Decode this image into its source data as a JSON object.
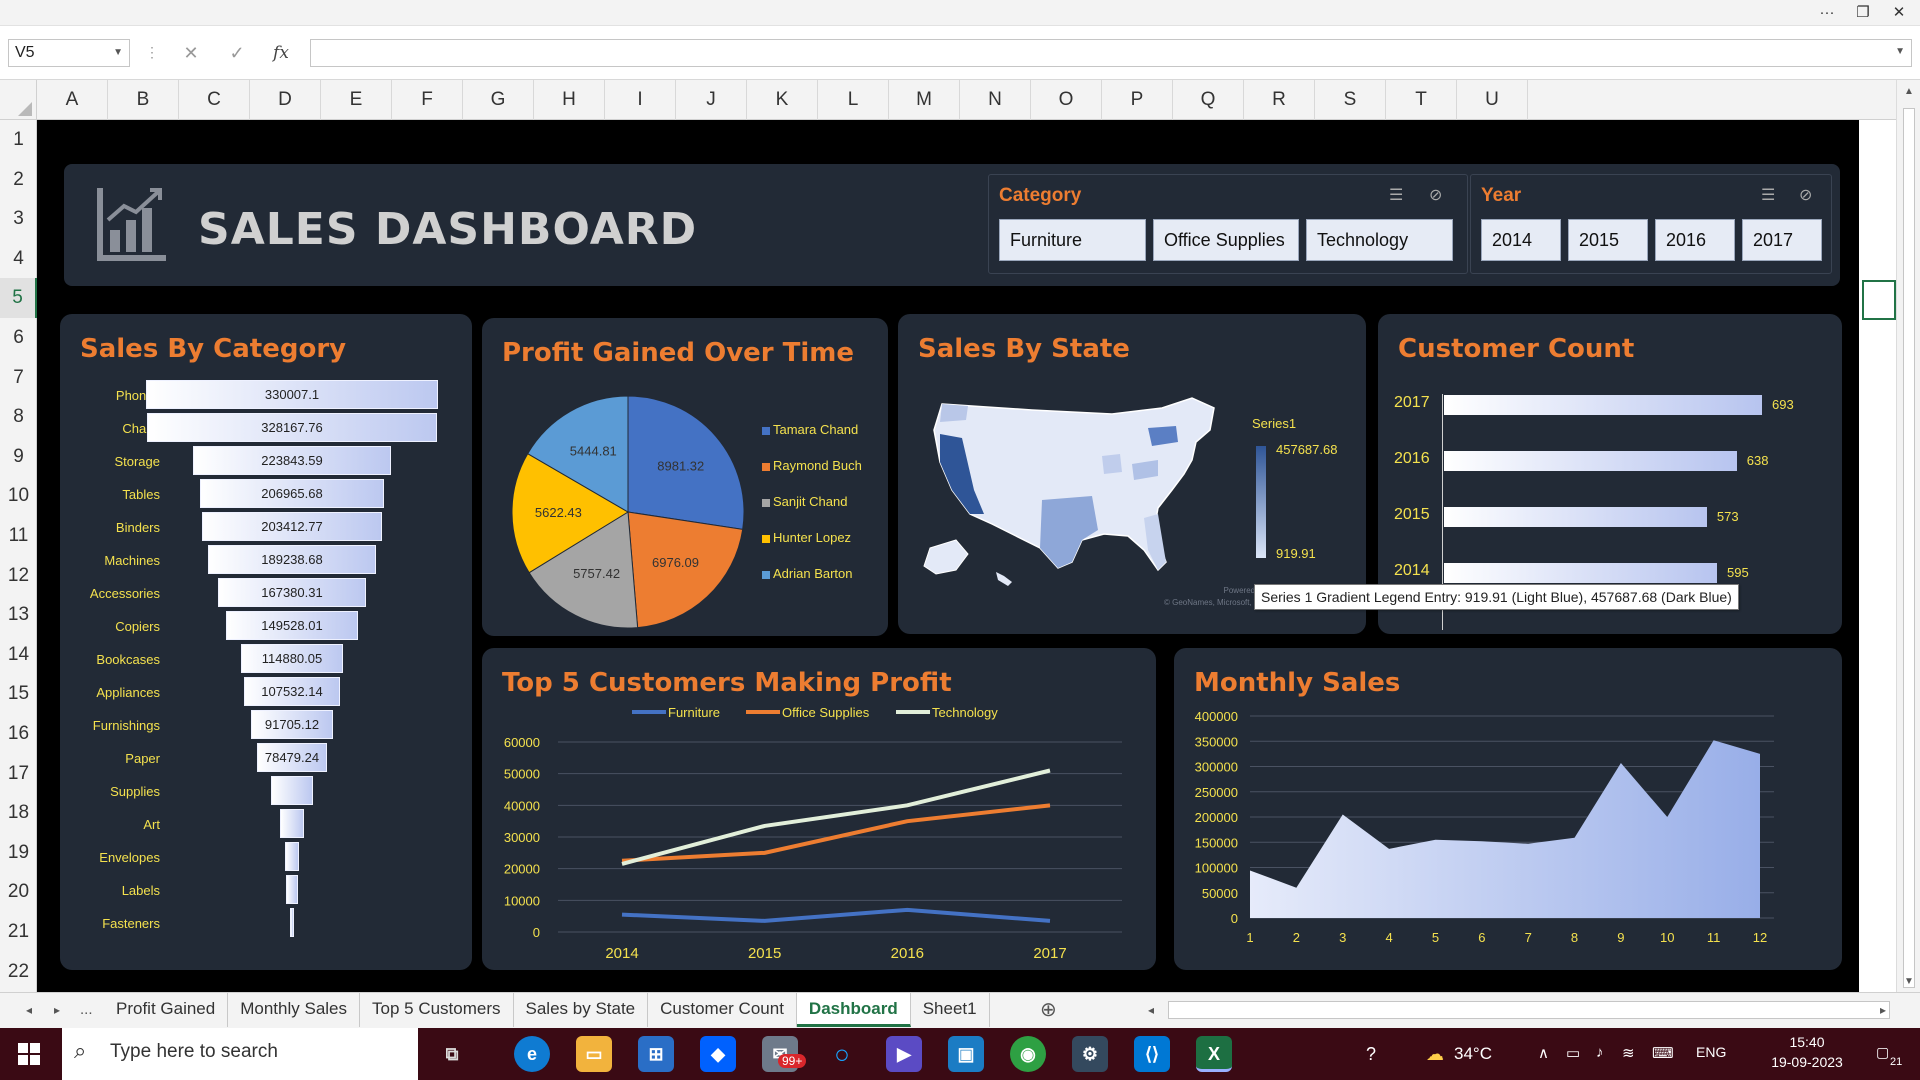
{
  "window": {
    "more_icon": "···",
    "restore_icon": "❐",
    "close_icon": "✕"
  },
  "formula_bar": {
    "name_box": "V5",
    "cancel_icon": "✕",
    "enter_icon": "✓",
    "fx_label": "fx",
    "formula_value": ""
  },
  "columns": [
    "A",
    "B",
    "C",
    "D",
    "E",
    "F",
    "G",
    "H",
    "I",
    "J",
    "K",
    "L",
    "M",
    "N",
    "O",
    "P",
    "Q",
    "R",
    "S",
    "T",
    "U"
  ],
  "rows": [
    "1",
    "2",
    "3",
    "4",
    "5",
    "6",
    "7",
    "8",
    "9",
    "10",
    "11",
    "12",
    "13",
    "14",
    "15",
    "16",
    "17",
    "18",
    "19",
    "20",
    "21",
    "22"
  ],
  "selected_row": "5",
  "dashboard": {
    "title": "SALES DASHBOARD",
    "category_slicer": {
      "title": "Category",
      "items": [
        "Furniture",
        "Office  Supplies",
        "Technology"
      ]
    },
    "year_slicer": {
      "title": "Year",
      "items": [
        "2014",
        "2015",
        "2016",
        "2017"
      ]
    }
  },
  "panels": {
    "sales_by_category": "Sales By Category",
    "profit_over_time": "Profit Gained Over Time",
    "sales_by_state": "Sales By State",
    "customer_count": "Customer Count",
    "top5": "Top 5 Customers Making Profit",
    "monthly": "Monthly Sales"
  },
  "map": {
    "legend_title": "Series1",
    "max_label": "457687.68",
    "min_label": "919.91",
    "credit_1": "Powered by Bing",
    "credit_2": "© GeoNames, Microsoft, TomTom",
    "tooltip": "Series 1 Gradient Legend Entry: 919.91 (Light Blue), 457687.68 (Dark Blue)"
  },
  "chart_data": [
    {
      "type": "bar",
      "title": "Sales By Category",
      "categories": [
        "Phones",
        "Chairs",
        "Storage",
        "Tables",
        "Binders",
        "Machines",
        "Accessories",
        "Copiers",
        "Bookcases",
        "Appliances",
        "Furnishings",
        "Paper",
        "Supplies",
        "Art",
        "Envelopes",
        "Labels",
        "Fasteners"
      ],
      "values": [
        330007.1,
        328167.76,
        223843.59,
        206965.68,
        203412.77,
        189238.68,
        167380.31,
        149528.01,
        114880.05,
        107532.14,
        91705.12,
        78479.24,
        46673,
        27119,
        16476,
        12486,
        3024
      ],
      "value_labels": [
        "330007.1",
        "328167.76",
        "223843.59",
        "206965.68",
        "203412.77",
        "189238.68",
        "167380.31",
        "149528.01",
        "114880.05",
        "107532.14",
        "91705.12",
        "78479.24",
        "",
        "",
        "",
        "",
        ""
      ]
    },
    {
      "type": "pie",
      "title": "Profit Gained Over Time",
      "labels": [
        "Tamara Chand",
        "Raymond Buch",
        "Sanjit Chand",
        "Hunter Lopez",
        "Adrian Barton"
      ],
      "values": [
        8981.32,
        6976.09,
        5757.42,
        5622.43,
        5444.81
      ],
      "value_labels": [
        "8981.32",
        "6976.09",
        "5757.42",
        "5622.43",
        "5444.81"
      ],
      "colors": [
        "#4472c4",
        "#ed7d31",
        "#a5a5a5",
        "#ffc000",
        "#5b9bd5"
      ]
    },
    {
      "type": "bar",
      "title": "Customer Count",
      "categories": [
        "2017",
        "2016",
        "2015",
        "2014"
      ],
      "values": [
        693,
        638,
        573,
        595
      ],
      "value_labels": [
        "693",
        "638",
        "573",
        "595"
      ]
    },
    {
      "type": "line",
      "title": "Top 5 Customers Making Profit",
      "x": [
        "2014",
        "2015",
        "2016",
        "2017"
      ],
      "ylim": [
        0,
        60000
      ],
      "yticks": [
        "0",
        "10000",
        "20000",
        "30000",
        "40000",
        "50000",
        "60000"
      ],
      "series": [
        {
          "name": "Furniture",
          "color": "#4472c4",
          "values": [
            5500,
            3500,
            7000,
            3500
          ]
        },
        {
          "name": "Office Supplies",
          "color": "#ed7d31",
          "values": [
            22500,
            25000,
            35000,
            40000
          ]
        },
        {
          "name": "Technology",
          "color": "#e2efda",
          "values": [
            21500,
            33500,
            40000,
            51000
          ]
        }
      ]
    },
    {
      "type": "area",
      "title": "Monthly Sales",
      "x": [
        "1",
        "2",
        "3",
        "4",
        "5",
        "6",
        "7",
        "8",
        "9",
        "10",
        "11",
        "12"
      ],
      "ylim": [
        0,
        400000
      ],
      "yticks": [
        "0",
        "50000",
        "100000",
        "150000",
        "200000",
        "250000",
        "300000",
        "350000",
        "400000"
      ],
      "values": [
        94000,
        60000,
        205000,
        137000,
        155000,
        152000,
        147000,
        159000,
        307000,
        200000,
        352000,
        325000
      ]
    }
  ],
  "sheet_tabs": {
    "nav_prev": "◂",
    "nav_next": "▸",
    "ellipsis": "...",
    "items": [
      "Profit Gained",
      "Monthly Sales",
      "Top 5 Customers",
      "Sales by State",
      "Customer Count",
      "Dashboard",
      "Sheet1"
    ],
    "active": "Dashboard",
    "add_icon": "⊕"
  },
  "taskbar": {
    "search_placeholder": "Type here to search",
    "badge": "99+",
    "weather": "34°C",
    "language": "ENG",
    "time": "15:40",
    "date": "19-09-2023",
    "notifications": "21"
  }
}
